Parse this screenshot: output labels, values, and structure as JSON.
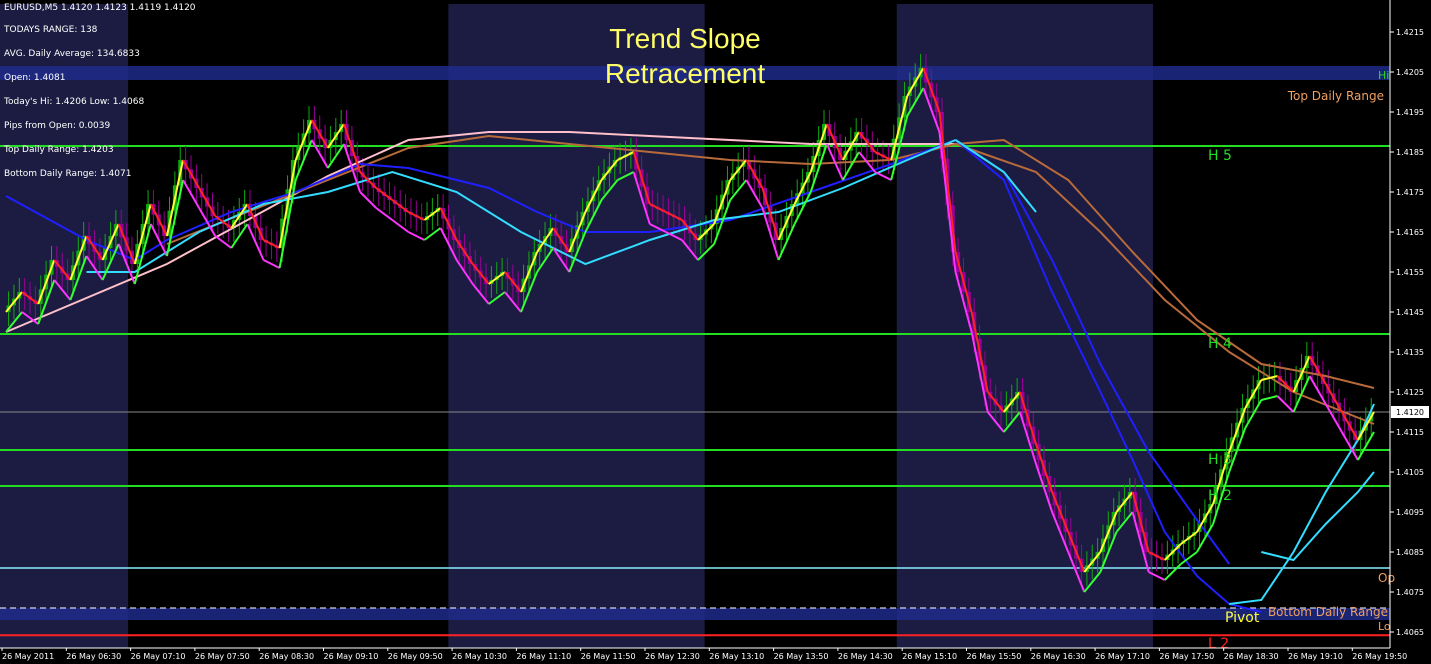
{
  "colors": {
    "bg": "#000000",
    "session_band": "#1c1c42",
    "range_band": "#1f2a8a",
    "pivot_green": "#22dd22",
    "open_line": "#88eeff",
    "low_line": "#ff2222",
    "ma_blue": "#1f1fff",
    "ma_cyan": "#33ddff",
    "ma_brown": "#b86a3a",
    "ma_pink": "#ffc0cb",
    "bull_candle": "#11aa11",
    "bear_candle": "#990099",
    "price_up": "#ffff33",
    "price_down": "#ff2222",
    "ma_fast_green": "#33ff33",
    "ma_fast_magenta": "#ff33ff",
    "axis_text": "#ffffff",
    "label_orange": "#f0a060",
    "label_yellow": "#ffff33"
  },
  "header": {
    "symbol_line": "EURUSD,M5  1.4120 1.4123 1.4119 1.4120",
    "todays_range": "TODAYS RANGE: 138",
    "avg_daily": "AVG. Daily Average: 134.6833",
    "open": "Open: 1.4081",
    "hi_low": "Today's Hi: 1.4206  Low: 1.4068",
    "pips_from_open": "Pips from Open: 0.0039",
    "top_daily_range": "Top Daily Range: 1.4203",
    "bottom_daily_range": "Bottom Daily Range: 1.4071"
  },
  "chart_title": [
    "Trend Slope",
    "Retracement"
  ],
  "chart_data": {
    "type": "candlestick",
    "symbol": "EURUSD",
    "timeframe": "M5",
    "ylim": [
      1.4061,
      1.4222
    ],
    "y_ticks": [
      "1.4215",
      "1.4205",
      "1.4195",
      "1.4185",
      "1.4175",
      "1.4165",
      "1.4155",
      "1.4145",
      "1.4135",
      "1.4125",
      "1.4115",
      "1.4105",
      "1.4095",
      "1.4085",
      "1.4075",
      "1.4065"
    ],
    "x_ticks": [
      "26 May 2011",
      "26 May 06:30",
      "26 May 07:10",
      "26 May 07:50",
      "26 May 08:30",
      "26 May 09:10",
      "26 May 09:50",
      "26 May 10:30",
      "26 May 11:10",
      "26 May 11:50",
      "26 May 12:30",
      "26 May 13:10",
      "26 May 13:50",
      "26 May 14:30",
      "26 May 15:10",
      "26 May 15:50",
      "26 May 16:30",
      "26 May 17:10",
      "26 May 17:50",
      "26 May 18:30",
      "26 May 19:10",
      "26 May 19:50"
    ],
    "current_price": "1.4120",
    "current_price_value": 1.412,
    "levels": [
      {
        "label": "H 5",
        "value": 1.41865,
        "type": "pivot"
      },
      {
        "label": "H 4",
        "value": 1.41395,
        "type": "pivot"
      },
      {
        "label": "H 3",
        "value": 1.41105,
        "type": "pivot"
      },
      {
        "label": "H 2",
        "value": 1.41015,
        "type": "pivot"
      },
      {
        "label": "Op",
        "value": 1.4081,
        "type": "open"
      },
      {
        "label": "Pivot",
        "value": 1.4071,
        "type": "pivot_dashed"
      },
      {
        "label": "L 2",
        "value": 1.40642,
        "type": "low"
      }
    ],
    "range_labels": {
      "top": "Top Daily Range",
      "bottom": "Bottom Daily Range",
      "top_right_cut": "Hi",
      "bottom_right_cut": "Lo"
    },
    "top_daily_range": 1.4203,
    "bottom_daily_range": 1.4071,
    "session_bands": [
      [
        0,
        2
      ],
      [
        7,
        11
      ],
      [
        14,
        18
      ]
    ],
    "price_path": [
      [
        0,
        1.4145
      ],
      [
        1,
        1.415
      ],
      [
        2,
        1.4147
      ],
      [
        3,
        1.4158
      ],
      [
        4,
        1.4153
      ],
      [
        5,
        1.4164
      ],
      [
        6,
        1.4158
      ],
      [
        7,
        1.4167
      ],
      [
        8,
        1.4157
      ],
      [
        9,
        1.4172
      ],
      [
        10,
        1.4164
      ],
      [
        11,
        1.4183
      ],
      [
        12,
        1.4176
      ],
      [
        13,
        1.4169
      ],
      [
        14,
        1.4166
      ],
      [
        15,
        1.4172
      ],
      [
        16,
        1.4163
      ],
      [
        17,
        1.4161
      ],
      [
        18,
        1.4183
      ],
      [
        19,
        1.4193
      ],
      [
        20,
        1.4186
      ],
      [
        21,
        1.4192
      ],
      [
        22,
        1.418
      ],
      [
        23,
        1.4176
      ],
      [
        24,
        1.4173
      ],
      [
        25,
        1.417
      ],
      [
        26,
        1.4168
      ],
      [
        27,
        1.4171
      ],
      [
        28,
        1.4163
      ],
      [
        29,
        1.4157
      ],
      [
        30,
        1.4152
      ],
      [
        31,
        1.4155
      ],
      [
        32,
        1.415
      ],
      [
        33,
        1.416
      ],
      [
        34,
        1.4166
      ],
      [
        35,
        1.416
      ],
      [
        36,
        1.417
      ],
      [
        37,
        1.4178
      ],
      [
        38,
        1.4183
      ],
      [
        39,
        1.4185
      ],
      [
        40,
        1.4172
      ],
      [
        41,
        1.417
      ],
      [
        42,
        1.4168
      ],
      [
        43,
        1.4163
      ],
      [
        44,
        1.4167
      ],
      [
        45,
        1.4178
      ],
      [
        46,
        1.4183
      ],
      [
        47,
        1.4176
      ],
      [
        48,
        1.4163
      ],
      [
        49,
        1.4172
      ],
      [
        50,
        1.418
      ],
      [
        51,
        1.4192
      ],
      [
        52,
        1.4183
      ],
      [
        53,
        1.419
      ],
      [
        54,
        1.4185
      ],
      [
        55,
        1.4183
      ],
      [
        56,
        1.4199
      ],
      [
        57,
        1.4206
      ],
      [
        58,
        1.4195
      ],
      [
        59,
        1.416
      ],
      [
        60,
        1.4145
      ],
      [
        61,
        1.4125
      ],
      [
        62,
        1.412
      ],
      [
        63,
        1.4125
      ],
      [
        64,
        1.4112
      ],
      [
        65,
        1.41
      ],
      [
        66,
        1.409
      ],
      [
        67,
        1.408
      ],
      [
        68,
        1.4085
      ],
      [
        69,
        1.4095
      ],
      [
        70,
        1.41
      ],
      [
        71,
        1.4085
      ],
      [
        72,
        1.4083
      ],
      [
        73,
        1.4087
      ],
      [
        74,
        1.409
      ],
      [
        75,
        1.4097
      ],
      [
        76,
        1.411
      ],
      [
        77,
        1.4121
      ],
      [
        78,
        1.4128
      ],
      [
        79,
        1.4129
      ],
      [
        80,
        1.4125
      ],
      [
        81,
        1.4134
      ],
      [
        82,
        1.4127
      ],
      [
        83,
        1.412
      ],
      [
        84,
        1.4113
      ],
      [
        85,
        1.412
      ]
    ],
    "series": [
      {
        "key": "ma_pink",
        "points": [
          [
            0,
            1.414
          ],
          [
            10,
            1.4157
          ],
          [
            20,
            1.4179
          ],
          [
            25,
            1.4188
          ],
          [
            30,
            1.419
          ],
          [
            35,
            1.419
          ],
          [
            40,
            1.4189
          ],
          [
            45,
            1.4188
          ],
          [
            50,
            1.4187
          ],
          [
            55,
            1.4187
          ],
          [
            59,
            1.4187
          ]
        ]
      },
      {
        "key": "ma_brown",
        "points": [
          [
            10,
            1.4162
          ],
          [
            20,
            1.4178
          ],
          [
            25,
            1.4186
          ],
          [
            30,
            1.4189
          ],
          [
            35,
            1.4187
          ],
          [
            40,
            1.4185
          ],
          [
            45,
            1.4183
          ],
          [
            50,
            1.4182
          ],
          [
            55,
            1.4183
          ],
          [
            59,
            1.4187
          ],
          [
            62,
            1.4188
          ],
          [
            66,
            1.4178
          ],
          [
            70,
            1.416
          ],
          [
            74,
            1.4143
          ],
          [
            78,
            1.4132
          ],
          [
            82,
            1.4129
          ],
          [
            85,
            1.4126
          ]
        ]
      },
      {
        "key": "ma_brown",
        "points": [
          [
            59,
            1.4187
          ],
          [
            64,
            1.418
          ],
          [
            68,
            1.4165
          ],
          [
            72,
            1.4148
          ],
          [
            76,
            1.4135
          ],
          [
            80,
            1.4125
          ],
          [
            85,
            1.4117
          ]
        ]
      },
      {
        "key": "ma_blue",
        "points": [
          [
            0,
            1.4174
          ],
          [
            5,
            1.4163
          ],
          [
            8,
            1.4158
          ],
          [
            10,
            1.4163
          ],
          [
            14,
            1.417
          ],
          [
            18,
            1.4175
          ],
          [
            22,
            1.4182
          ],
          [
            25,
            1.4181
          ],
          [
            30,
            1.4176
          ],
          [
            33,
            1.417
          ],
          [
            36,
            1.4165
          ],
          [
            40,
            1.4165
          ],
          [
            45,
            1.4168
          ],
          [
            50,
            1.4175
          ],
          [
            55,
            1.4182
          ],
          [
            59,
            1.4188
          ],
          [
            62,
            1.4178
          ],
          [
            65,
            1.415
          ],
          [
            68,
            1.4125
          ],
          [
            70,
            1.4108
          ],
          [
            72,
            1.409
          ],
          [
            74,
            1.4079
          ],
          [
            76,
            1.4072
          ],
          [
            78,
            1.407
          ]
        ]
      },
      {
        "key": "ma_blue",
        "points": [
          [
            59,
            1.4188
          ],
          [
            62,
            1.418
          ],
          [
            65,
            1.4158
          ],
          [
            68,
            1.4132
          ],
          [
            71,
            1.411
          ],
          [
            74,
            1.4093
          ],
          [
            76,
            1.4082
          ]
        ]
      },
      {
        "key": "ma_cyan",
        "points": [
          [
            5,
            1.4155
          ],
          [
            8,
            1.4155
          ],
          [
            12,
            1.4165
          ],
          [
            16,
            1.4172
          ],
          [
            20,
            1.4175
          ],
          [
            24,
            1.418
          ],
          [
            28,
            1.4175
          ],
          [
            32,
            1.4165
          ],
          [
            36,
            1.4157
          ],
          [
            40,
            1.4163
          ],
          [
            44,
            1.4168
          ],
          [
            48,
            1.417
          ],
          [
            52,
            1.4176
          ],
          [
            56,
            1.4183
          ],
          [
            59,
            1.4188
          ]
        ]
      },
      {
        "key": "ma_cyan",
        "points": [
          [
            59,
            1.4188
          ],
          [
            62,
            1.418
          ],
          [
            64,
            1.417
          ]
        ]
      },
      {
        "key": "ma_cyan",
        "points": [
          [
            78,
            1.4085
          ],
          [
            80,
            1.4083
          ],
          [
            82,
            1.4092
          ],
          [
            84,
            1.41
          ],
          [
            85,
            1.4105
          ]
        ]
      },
      {
        "key": "ma_cyan",
        "points": [
          [
            76,
            1.4072
          ],
          [
            78,
            1.4073
          ],
          [
            80,
            1.4085
          ],
          [
            82,
            1.41
          ],
          [
            84,
            1.4113
          ],
          [
            85,
            1.4122
          ]
        ]
      }
    ]
  }
}
